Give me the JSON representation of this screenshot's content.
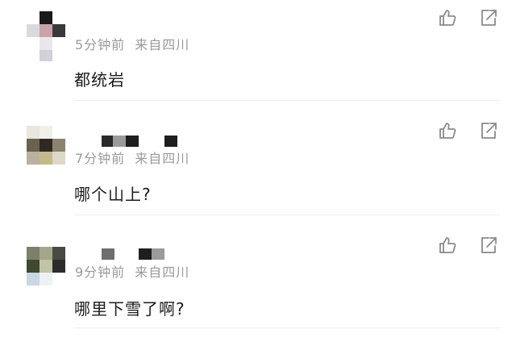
{
  "comments": [
    {
      "time": "5分钟前",
      "location": "来自四川",
      "text": "都统岩",
      "avatar_icon": "pixelated-avatar",
      "like_icon": "thumbs-up-icon",
      "share_icon": "share-icon"
    },
    {
      "time": "7分钟前",
      "location": "来自四川",
      "text": "哪个山上?",
      "avatar_icon": "pixelated-avatar",
      "like_icon": "thumbs-up-icon",
      "share_icon": "share-icon"
    },
    {
      "time": "9分钟前",
      "location": "来自四川",
      "text": "哪里下雪了啊?",
      "avatar_icon": "pixelated-avatar",
      "like_icon": "thumbs-up-icon",
      "share_icon": "share-icon"
    }
  ],
  "colors": {
    "meta_text": "#9a9a9a",
    "body_text": "#1c1c1c",
    "icon_stroke": "#8a8a8a",
    "divider": "#eeeeee"
  }
}
